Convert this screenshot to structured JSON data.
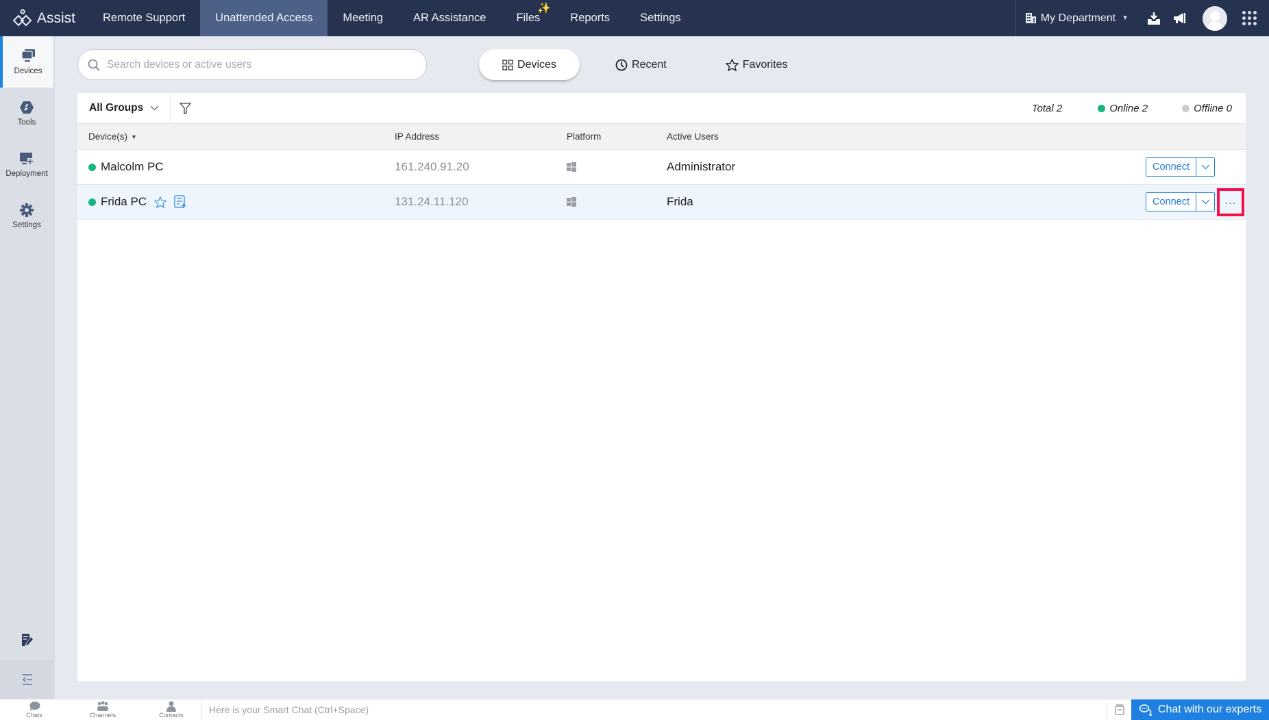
{
  "app": {
    "name": "Assist"
  },
  "nav": {
    "items": [
      {
        "label": "Remote Support",
        "active": false
      },
      {
        "label": "Unattended Access",
        "active": true
      },
      {
        "label": "Meeting",
        "active": false
      },
      {
        "label": "AR Assistance",
        "active": false
      },
      {
        "label": "Files",
        "active": false,
        "badge": "sparkle-icon"
      },
      {
        "label": "Reports",
        "active": false
      },
      {
        "label": "Settings",
        "active": false
      }
    ],
    "department": "My Department"
  },
  "sidebar": {
    "items": [
      {
        "label": "Devices",
        "icon": "devices-icon",
        "active": true
      },
      {
        "label": "Tools",
        "icon": "tools-icon",
        "active": false
      },
      {
        "label": "Deployment",
        "icon": "deployment-icon",
        "active": false
      },
      {
        "label": "Settings",
        "icon": "gear-icon",
        "active": false
      }
    ]
  },
  "search": {
    "placeholder": "Search devices or active users",
    "value": ""
  },
  "view_tabs": [
    {
      "label": "Devices",
      "icon": "grid-icon",
      "active": true
    },
    {
      "label": "Recent",
      "icon": "clock-icon",
      "active": false
    },
    {
      "label": "Favorites",
      "icon": "star-icon",
      "active": false
    }
  ],
  "filterbar": {
    "group": "All Groups",
    "total": "Total 2",
    "online": "Online 2",
    "offline": "Offline 0"
  },
  "colors": {
    "online": "#17b681",
    "offline": "#cccccc",
    "accent": "#1e80e0",
    "highlight": "#f5104a",
    "topbar": "#263350"
  },
  "table": {
    "columns": [
      "Device(s)",
      "IP Address",
      "Platform",
      "Active Users"
    ],
    "rows": [
      {
        "device": "Malcolm PC",
        "status": "online",
        "ip": "161.240.91.20",
        "platform": "Windows",
        "user": "Administrator",
        "action": "Connect"
      },
      {
        "device": "Frida PC",
        "status": "online",
        "ip": "131.24.11.120",
        "platform": "Windows",
        "user": "Frida",
        "action": "Connect",
        "more": "..."
      }
    ]
  },
  "bottombar": {
    "items": [
      {
        "label": "Chats"
      },
      {
        "label": "Channels"
      },
      {
        "label": "Contacts"
      }
    ],
    "smart_chat_placeholder": "Here is your Smart Chat (Ctrl+Space)",
    "expert_button": "Chat with our experts"
  }
}
